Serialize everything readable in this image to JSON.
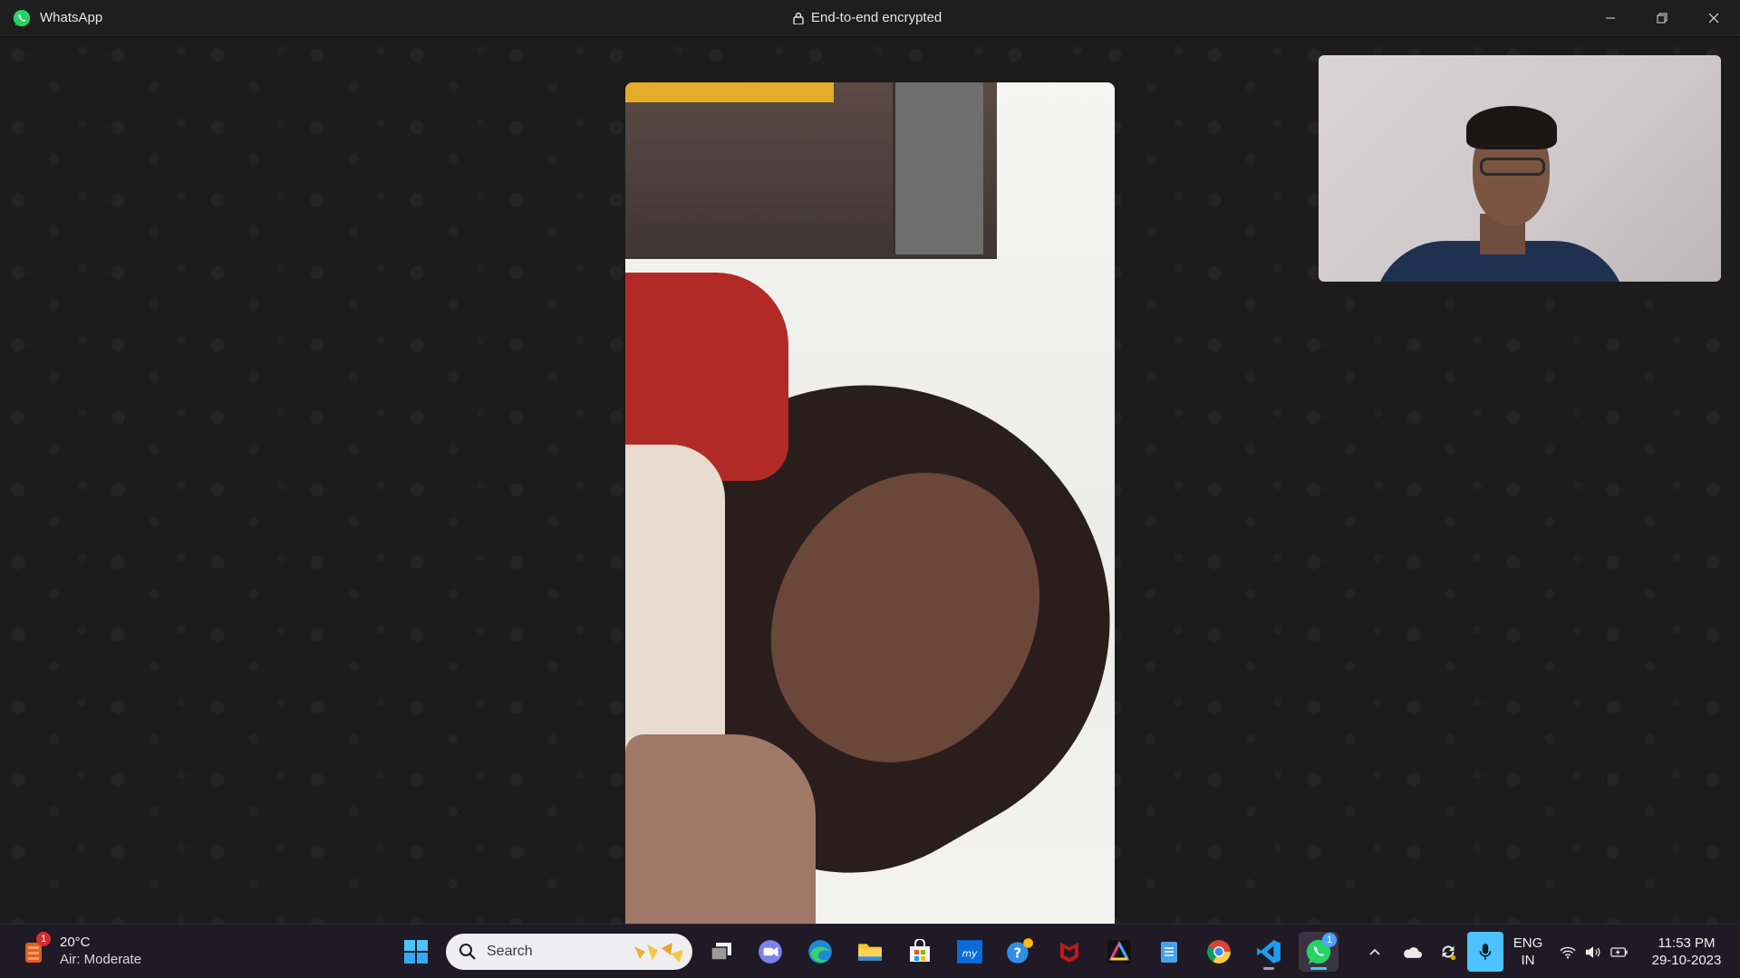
{
  "window": {
    "app_name": "WhatsApp",
    "encryption_label": "End-to-end encrypted"
  },
  "call": {
    "remote_video": "remote-participant-video",
    "self_video": "self-preview-video"
  },
  "taskbar": {
    "weather": {
      "temperature": "20°C",
      "condition": "Air: Moderate",
      "badge_count": "1"
    },
    "search": {
      "placeholder": "Search"
    },
    "pinned_apps": [
      {
        "name": "start-menu-icon"
      },
      {
        "name": "task-view-icon"
      },
      {
        "name": "teams-chat-icon"
      },
      {
        "name": "edge-icon"
      },
      {
        "name": "file-explorer-icon"
      },
      {
        "name": "microsoft-store-icon"
      },
      {
        "name": "myhp-icon"
      },
      {
        "name": "get-help-icon"
      },
      {
        "name": "mcafee-icon"
      },
      {
        "name": "arc-app-icon"
      },
      {
        "name": "notepad-icon"
      },
      {
        "name": "chrome-icon"
      },
      {
        "name": "vscode-icon"
      },
      {
        "name": "whatsapp-taskbar-icon",
        "badge": "1"
      }
    ],
    "tray": {
      "language_line1": "ENG",
      "language_line2": "IN",
      "time": "11:53 PM",
      "date": "29-10-2023"
    }
  },
  "colors": {
    "title_bar": "#1e1e1e",
    "call_background": "#1c1c1c",
    "taskbar": "#1f1a25",
    "whatsapp_green": "#25d366",
    "mic_active": "#4cc2ff"
  }
}
